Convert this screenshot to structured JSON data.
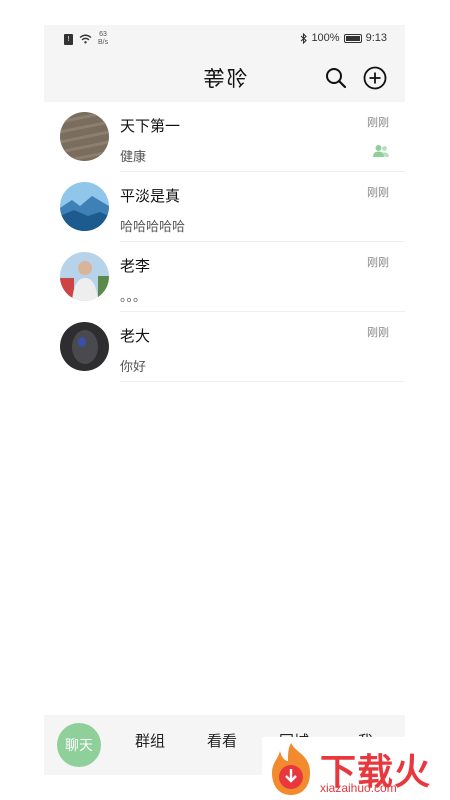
{
  "status_bar": {
    "speed_top": "63",
    "speed_unit": "B/s",
    "battery": "100%",
    "time": "9:13"
  },
  "header": {
    "title": "邻等"
  },
  "chats": [
    {
      "name": "天下第一",
      "message": "健康",
      "time": "刚刚"
    },
    {
      "name": "平淡是真",
      "message": "哈哈哈哈哈",
      "time": "刚刚"
    },
    {
      "name": "老李",
      "message": "。。。",
      "time": "刚刚"
    },
    {
      "name": "老大",
      "message": "你好",
      "time": "刚刚"
    }
  ],
  "tabs": {
    "chat": "聊天",
    "groups": "群组",
    "watch": "看看",
    "city": "同城",
    "me": "我"
  },
  "watermark": {
    "text": "下载火",
    "site": "xiazaihuo.com"
  },
  "colors": {
    "accent": "#8ecf9a",
    "watermark_red": "#e8383d"
  }
}
